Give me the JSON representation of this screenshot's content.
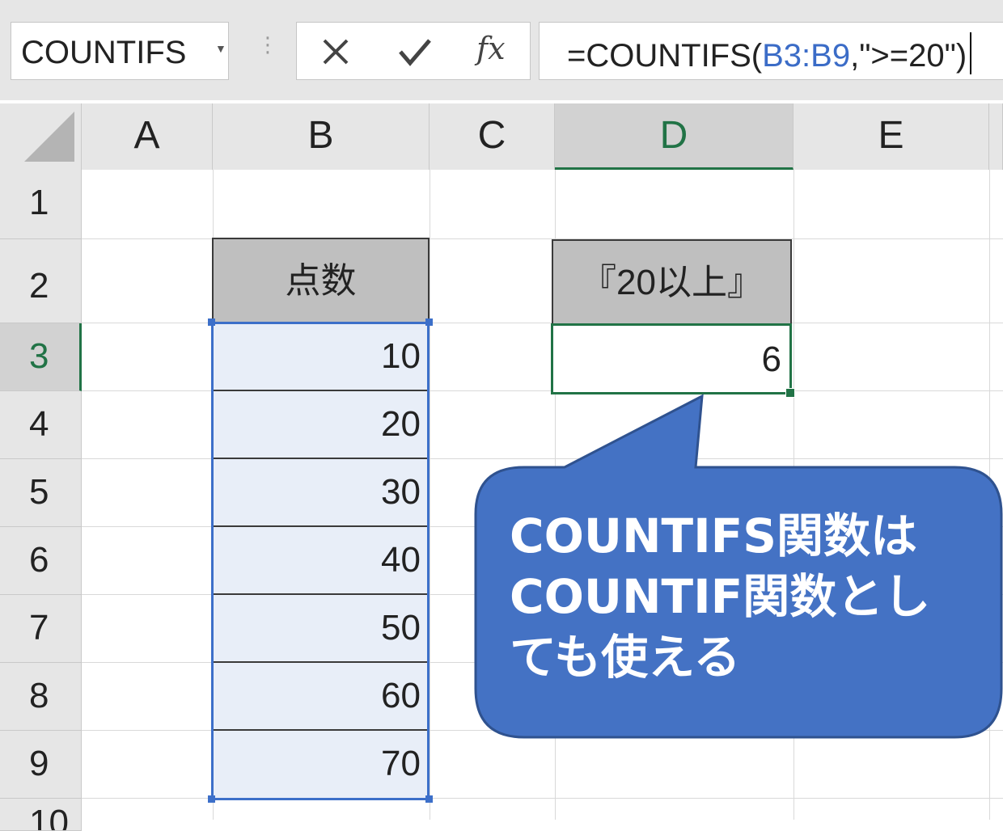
{
  "name_box": {
    "value": "COUNTIFS"
  },
  "formula_bar": {
    "prefix": "=COUNTIFS(",
    "range": "B3:B9",
    "suffix": ",\">=20\")",
    "insert_function_label": "fx"
  },
  "columns": [
    "A",
    "B",
    "C",
    "D",
    "E"
  ],
  "rows": [
    "1",
    "2",
    "3",
    "4",
    "5",
    "6",
    "7",
    "8",
    "9",
    "10"
  ],
  "table": {
    "header": "点数",
    "values": [
      "10",
      "20",
      "30",
      "40",
      "50",
      "60",
      "70"
    ]
  },
  "result": {
    "header": "『20以上』",
    "value": "6"
  },
  "callout": {
    "lines": [
      "COUNTIFS関数は",
      "COUNTIF関数とし",
      "ても使える"
    ]
  },
  "colors": {
    "callout_fill": "#4472c4",
    "selection_blue": "#3c6fc9",
    "excel_green": "#217346",
    "header_fill": "#bfbfbf"
  }
}
